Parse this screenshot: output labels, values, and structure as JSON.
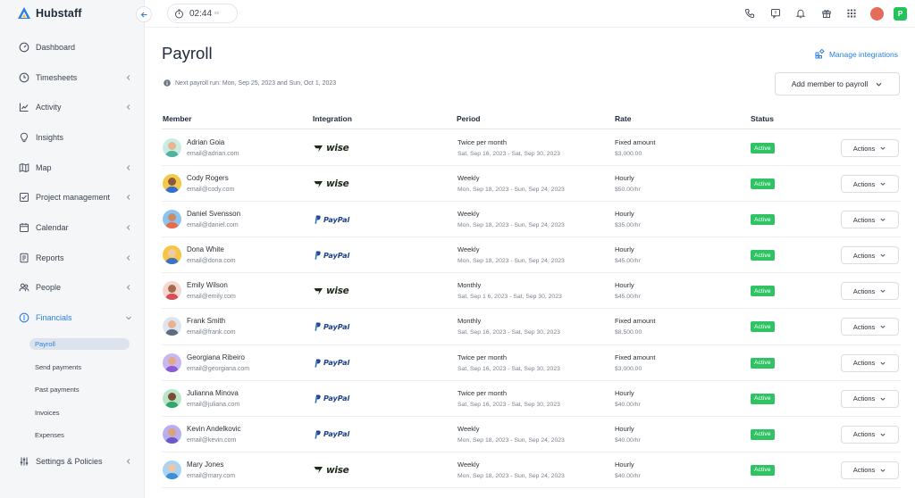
{
  "app": {
    "name": "Hubstaff"
  },
  "colors": {
    "accent": "#2b7fe0",
    "active_status": "#2fc364",
    "user_badge": "#23c35a"
  },
  "sidebar": {
    "items": [
      {
        "label": "Dashboard",
        "icon": "dashboard-icon",
        "chevron": false
      },
      {
        "label": "Timesheets",
        "icon": "clock-icon",
        "chevron": true
      },
      {
        "label": "Activity",
        "icon": "activity-icon",
        "chevron": true
      },
      {
        "label": "Insights",
        "icon": "lightbulb-icon",
        "chevron": false
      },
      {
        "label": "Map",
        "icon": "map-icon",
        "chevron": true
      },
      {
        "label": "Project management",
        "icon": "checklist-icon",
        "chevron": true
      },
      {
        "label": "Calendar",
        "icon": "calendar-icon",
        "chevron": true
      },
      {
        "label": "Reports",
        "icon": "reports-icon",
        "chevron": true
      },
      {
        "label": "People",
        "icon": "people-icon",
        "chevron": true
      },
      {
        "label": "Financials",
        "icon": "dollar-icon",
        "chevron": true,
        "active": true
      }
    ],
    "financials_sub": [
      {
        "label": "Payroll",
        "active": true
      },
      {
        "label": "Send payments"
      },
      {
        "label": "Past payments"
      },
      {
        "label": "Invoices"
      },
      {
        "label": "Expenses"
      }
    ],
    "bottom_item": {
      "label": "Settings & Policies",
      "icon": "sliders-icon"
    }
  },
  "topbar": {
    "timer": "02:44",
    "timer_suffix": "ss",
    "user_initial": "P",
    "icons": [
      "phone-icon",
      "chat-icon",
      "bell-icon",
      "gift-icon",
      "apps-grid-icon",
      "avatar"
    ]
  },
  "page": {
    "title": "Payroll",
    "manage_integrations": "Manage integrations",
    "next_run": "Next payroll run: Mon, Sep 25, 2023 and Sun, Oct 1, 2023",
    "add_member": "Add member to payroll"
  },
  "table": {
    "headers": {
      "member": "Member",
      "integration": "Integration",
      "period": "Period",
      "rate": "Rate",
      "status": "Status"
    },
    "rows": [
      {
        "name": "Adrian Goia",
        "email": "email@adrian.com",
        "integration": "wise",
        "integration_label": "wise",
        "period": "Twice per month",
        "period_range": "Sat, Sep 16, 2023 - Sat, Sep 30, 2023",
        "rate": "Fixed amount",
        "rate_value": "$3,000.00",
        "status": "Active",
        "actions": "Actions",
        "skin": "#e9b48f",
        "shirt": "#4fb3a1",
        "bg": "#c9ece5"
      },
      {
        "name": "Cody Rogers",
        "email": "email@cody.com",
        "integration": "wise",
        "integration_label": "wise",
        "period": "Weekly",
        "period_range": "Mon, Sep 18, 2023 - Sun, Sep 24, 2023",
        "rate": "Hourly",
        "rate_value": "$50.00/hr",
        "status": "Active",
        "actions": "Actions",
        "skin": "#8a5a3c",
        "shirt": "#2f6fd1",
        "bg": "#f2c94c"
      },
      {
        "name": "Daniel Svensson",
        "email": "email@daniel.com",
        "integration": "paypal",
        "integration_label": "PayPal",
        "period": "Weekly",
        "period_range": "Mon, Sep 18, 2023 - Sun, Sep 24, 2023",
        "rate": "Hourly",
        "rate_value": "$35.00/hr",
        "status": "Active",
        "actions": "Actions",
        "skin": "#c98c66",
        "shirt": "#e86a4a",
        "bg": "#8bc4f0"
      },
      {
        "name": "Dona White",
        "email": "email@dona.com",
        "integration": "paypal",
        "integration_label": "PayPal",
        "period": "Weekly",
        "period_range": "Mon, Sep 18, 2023 - Sun, Sep 24, 2023",
        "rate": "Hourly",
        "rate_value": "$45.00/hr",
        "status": "Active",
        "actions": "Actions",
        "skin": "#f0c9a8",
        "shirt": "#3b72c7",
        "bg": "#f5c543"
      },
      {
        "name": "Emily Wilson",
        "email": "email@emily.com",
        "integration": "wise",
        "integration_label": "wise",
        "period": "Monthly",
        "period_range": "Sat, Sep 1 6, 2023 - Sat, Sep 30, 2023",
        "rate": "Hourly",
        "rate_value": "$45.00/hr",
        "status": "Active",
        "actions": "Actions",
        "skin": "#a66a4a",
        "shirt": "#d84d5a",
        "bg": "#f4d7d0"
      },
      {
        "name": "Frank Smith",
        "email": "email@frank.com",
        "integration": "paypal",
        "integration_label": "PayPal",
        "period": "Monthly",
        "period_range": "Sat, Sep 16, 2023 - Sat, Sep 30, 2023",
        "rate": "Fixed amount",
        "rate_value": "$8,500.00",
        "status": "Active",
        "actions": "Actions",
        "skin": "#e6b491",
        "shirt": "#5a6b84",
        "bg": "#dfe5ee"
      },
      {
        "name": "Georgiana Ribeiro",
        "email": "email@georgiana.com",
        "integration": "paypal",
        "integration_label": "PayPal",
        "period": "Twice per month",
        "period_range": "Sat, Sep 16, 2023 - Sat, Sep 30, 2023",
        "rate": "Fixed amount",
        "rate_value": "$3,000.00",
        "status": "Active",
        "actions": "Actions",
        "skin": "#e3a88a",
        "shirt": "#8a5bd6",
        "bg": "#c9b7f0"
      },
      {
        "name": "Julianna Minova",
        "email": "email@juliana.com",
        "integration": "paypal",
        "integration_label": "PayPal",
        "period": "Twice per month",
        "period_range": "Sat, Sep 16, 2023 - Sat, Sep 30, 2023",
        "rate": "Hourly",
        "rate_value": "$40.00/hr",
        "status": "Active",
        "actions": "Actions",
        "skin": "#7a4a34",
        "shirt": "#2fa66b",
        "bg": "#b9e6c6"
      },
      {
        "name": "Kevin Andelkovic",
        "email": "email@kevin.com",
        "integration": "paypal",
        "integration_label": "PayPal",
        "period": "Weekly",
        "period_range": "Mon, Sep 18, 2023 - Sun, Sep 24, 2023",
        "rate": "Hourly",
        "rate_value": "$40.00/hr",
        "status": "Active",
        "actions": "Actions",
        "skin": "#d9a27a",
        "shirt": "#6b58c9",
        "bg": "#b8aef0"
      },
      {
        "name": "Mary Jones",
        "email": "email@mary.com",
        "integration": "wise",
        "integration_label": "wise",
        "period": "Weekly",
        "period_range": "Mon, Sep 18, 2023 - Sun, Sep 24, 2023",
        "rate": "Hourly",
        "rate_value": "$40.00/hr",
        "status": "Active",
        "actions": "Actions",
        "skin": "#f0c5a3",
        "shirt": "#3b8fd6",
        "bg": "#a9d3f5"
      }
    ]
  }
}
